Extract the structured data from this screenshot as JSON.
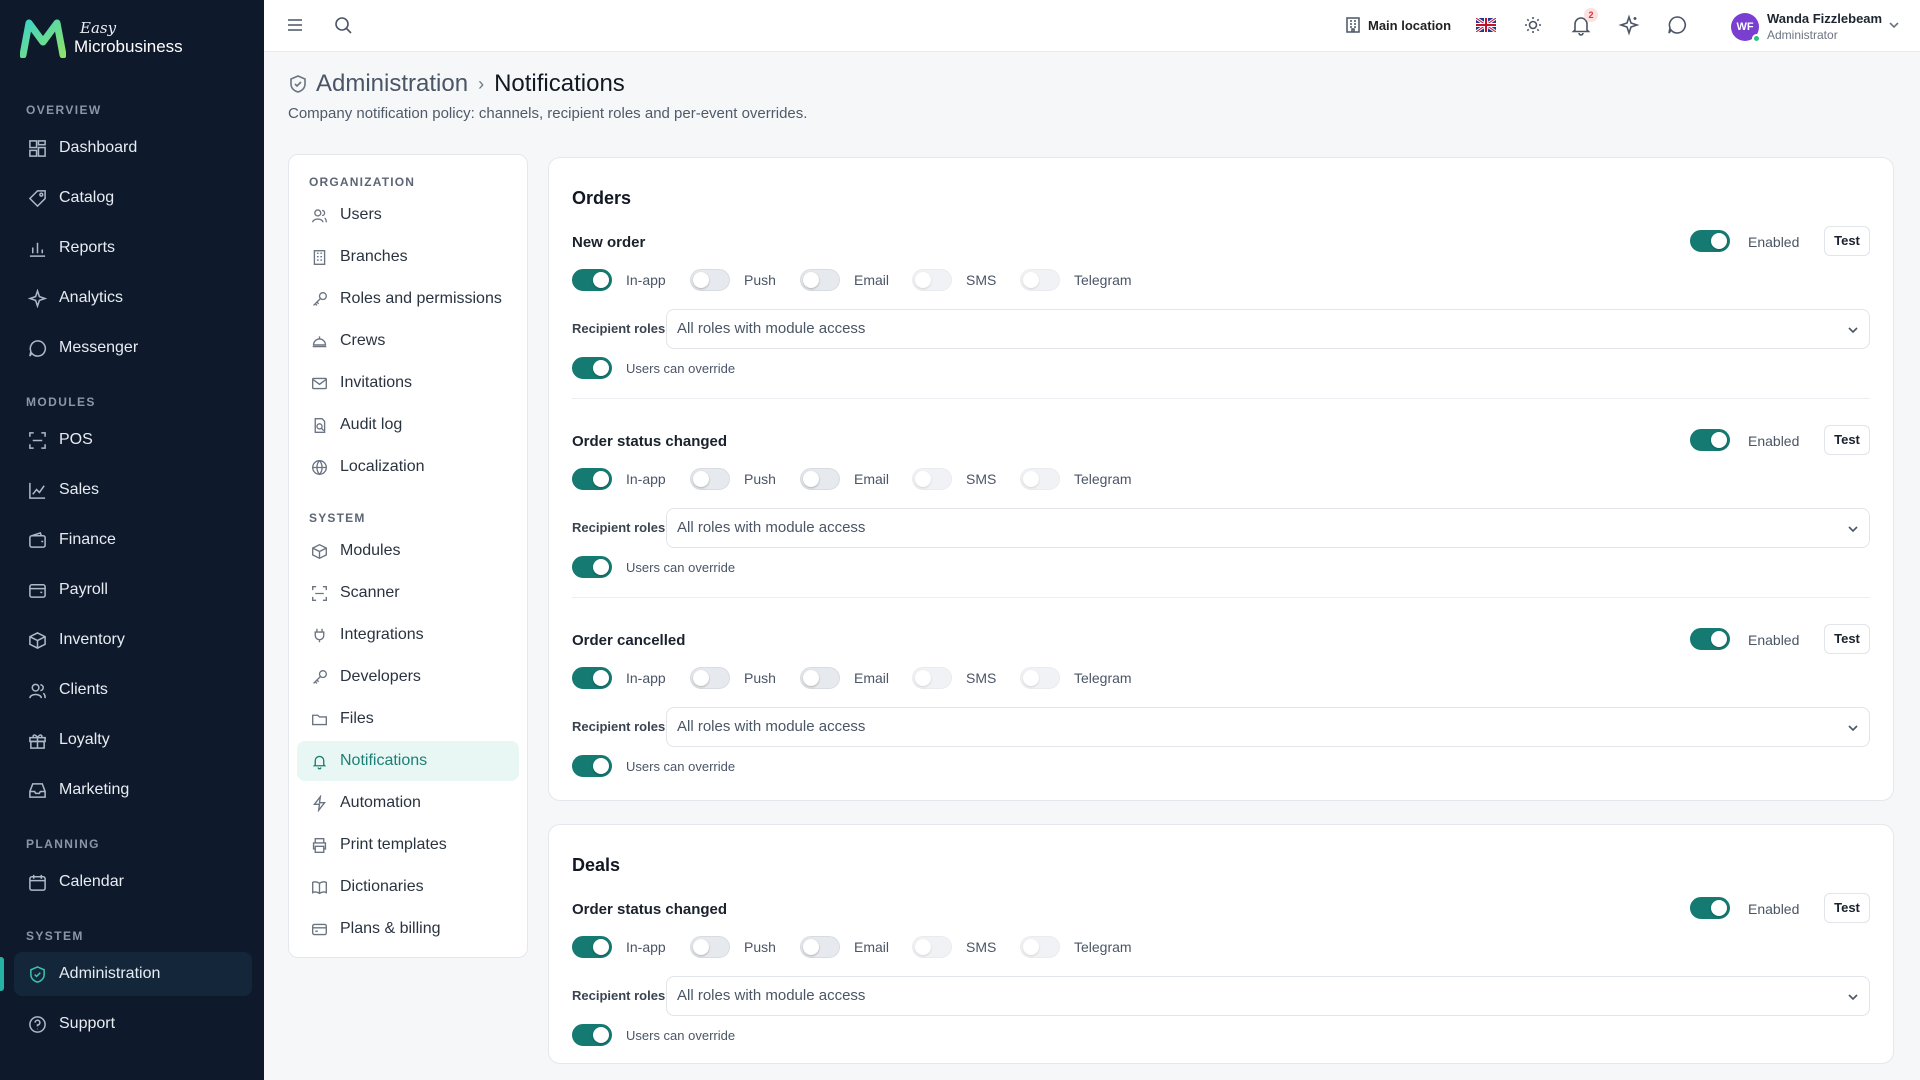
{
  "app": {
    "logo_easy": "Easy",
    "logo_name": "Microbusiness"
  },
  "sidebar": {
    "sections": [
      {
        "label": "OVERVIEW"
      },
      {
        "label": "MODULES"
      },
      {
        "label": "PLANNING"
      },
      {
        "label": "SYSTEM"
      }
    ],
    "items": [
      {
        "label": "Dashboard",
        "icon": "dashboard-icon"
      },
      {
        "label": "Catalog",
        "icon": "tag-icon"
      },
      {
        "label": "Reports",
        "icon": "bar-chart-icon"
      },
      {
        "label": "Analytics",
        "icon": "sparkle-icon"
      },
      {
        "label": "Messenger",
        "icon": "chat-icon"
      },
      {
        "label": "POS",
        "icon": "scan-icon"
      },
      {
        "label": "Sales",
        "icon": "line-chart-icon"
      },
      {
        "label": "Finance",
        "icon": "wallet-icon"
      },
      {
        "label": "Payroll",
        "icon": "payroll-icon"
      },
      {
        "label": "Inventory",
        "icon": "box-icon"
      },
      {
        "label": "Clients",
        "icon": "users-icon"
      },
      {
        "label": "Loyalty",
        "icon": "gift-icon"
      },
      {
        "label": "Marketing",
        "icon": "inbox-icon"
      },
      {
        "label": "Calendar",
        "icon": "calendar-icon"
      },
      {
        "label": "Administration",
        "icon": "shield-icon",
        "active": true
      },
      {
        "label": "Support",
        "icon": "help-icon"
      }
    ]
  },
  "topbar": {
    "location": "Main location",
    "notification_count": "2",
    "user_initials": "WF",
    "user_name": "Wanda Fizzlebeam",
    "user_role": "Administrator"
  },
  "header": {
    "breadcrumb_parent": "Administration",
    "breadcrumb_separator": "›",
    "title": "Notifications",
    "subtitle": "Company notification policy: channels, recipient roles and per-event overrides."
  },
  "settings_nav": {
    "sections": [
      {
        "label": "ORGANIZATION"
      },
      {
        "label": "SYSTEM"
      }
    ],
    "items": [
      {
        "label": "Users",
        "icon": "users-icon"
      },
      {
        "label": "Branches",
        "icon": "building-icon"
      },
      {
        "label": "Roles and permissions",
        "icon": "key-icon"
      },
      {
        "label": "Crews",
        "icon": "crew-icon"
      },
      {
        "label": "Invitations",
        "icon": "mail-icon"
      },
      {
        "label": "Audit log",
        "icon": "audit-icon"
      },
      {
        "label": "Localization",
        "icon": "globe-icon"
      },
      {
        "label": "Modules",
        "icon": "cube-icon"
      },
      {
        "label": "Scanner",
        "icon": "scan-icon"
      },
      {
        "label": "Integrations",
        "icon": "plug-icon"
      },
      {
        "label": "Developers",
        "icon": "key-icon"
      },
      {
        "label": "Files",
        "icon": "folder-icon"
      },
      {
        "label": "Notifications",
        "icon": "bell-icon",
        "active": true
      },
      {
        "label": "Automation",
        "icon": "bolt-icon"
      },
      {
        "label": "Print templates",
        "icon": "printer-icon"
      },
      {
        "label": "Dictionaries",
        "icon": "book-icon"
      },
      {
        "label": "Plans & billing",
        "icon": "card-icon"
      }
    ]
  },
  "labels": {
    "enabled": "Enabled",
    "test": "Test",
    "recipient_roles": "Recipient roles",
    "users_can_override": "Users can override",
    "channels": [
      "In-app",
      "Push",
      "Email",
      "SMS",
      "Telegram"
    ]
  },
  "colors": {
    "accent": "#157a71",
    "sidebar_bg": "#0e1a2b",
    "active_nav_bg": "#e8f6f4"
  },
  "groups": [
    {
      "title": "Orders",
      "events": [
        {
          "title": "New order",
          "enabled": true,
          "channels": [
            true,
            false,
            false,
            false,
            false
          ],
          "roles": "All roles with module access",
          "override": true
        },
        {
          "title": "Order status changed",
          "enabled": true,
          "channels": [
            true,
            false,
            false,
            false,
            false
          ],
          "roles": "All roles with module access",
          "override": true
        },
        {
          "title": "Order cancelled",
          "enabled": true,
          "channels": [
            true,
            false,
            false,
            false,
            false
          ],
          "roles": "All roles with module access",
          "override": true
        }
      ]
    },
    {
      "title": "Deals",
      "events": [
        {
          "title": "Order status changed",
          "enabled": true,
          "channels": [
            true,
            false,
            false,
            false,
            false
          ],
          "roles": "All roles with module access",
          "override": true
        }
      ]
    }
  ]
}
